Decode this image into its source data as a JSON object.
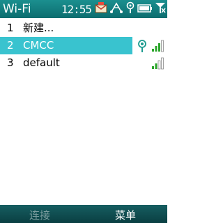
{
  "titlebar": {
    "title": "Wi-Fi",
    "time": "12:55"
  },
  "status_icons": [
    "envelope-icon",
    "network-connection-icon",
    "wifi-antenna-icon",
    "battery-icon",
    "no-signal-icon"
  ],
  "networks": [
    {
      "index": "1",
      "label": "新建...",
      "selected": false,
      "signal_bars": 0
    },
    {
      "index": "2",
      "label": "CMCC",
      "selected": true,
      "signal_bars": 3,
      "icon": "wifi-antenna-icon"
    },
    {
      "index": "3",
      "label": "default",
      "selected": false,
      "signal_bars": 2
    }
  ],
  "softkeys": {
    "left": "连接",
    "right": "菜单"
  },
  "colors": {
    "titlebar": "#0c6d6f",
    "selection": "#39c3cf",
    "signal": "#2aa52a"
  }
}
